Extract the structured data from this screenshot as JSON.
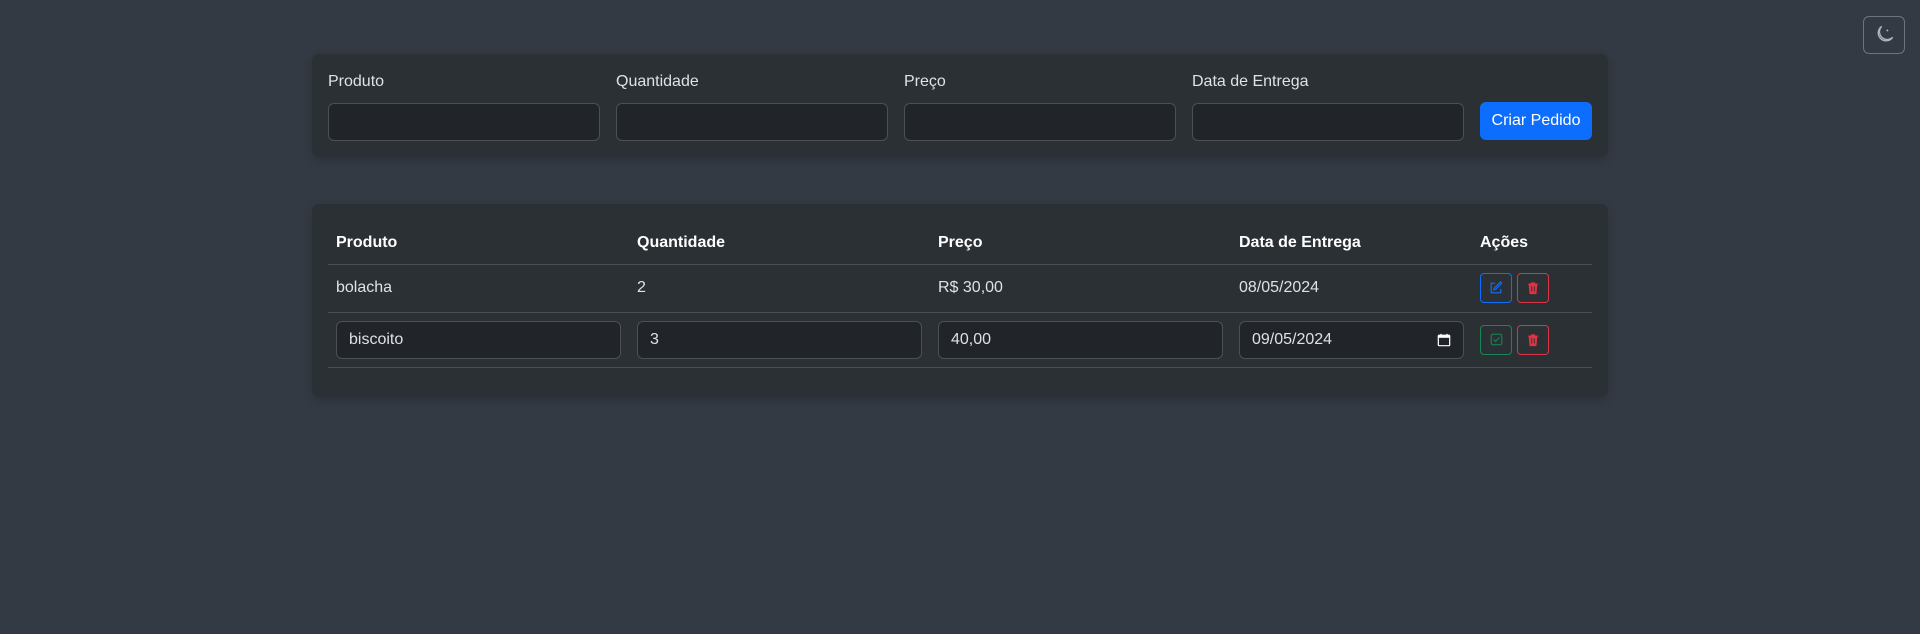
{
  "theme_toggle": {
    "icon": "moon-stars-icon"
  },
  "form": {
    "fields": [
      {
        "label": "Produto",
        "value": ""
      },
      {
        "label": "Quantidade",
        "value": ""
      },
      {
        "label": "Preço",
        "value": ""
      },
      {
        "label": "Data de Entrega",
        "value": ""
      }
    ],
    "submit_label": "Criar Pedido"
  },
  "table": {
    "headers": [
      "Produto",
      "Quantidade",
      "Preço",
      "Data de Entrega",
      "Ações"
    ],
    "rows": [
      {
        "produto": "bolacha",
        "quantidade": "2",
        "preco": "R$ 30,00",
        "data": "08/05/2024",
        "mode": "view"
      },
      {
        "produto": "biscoito",
        "quantidade": "3",
        "preco": "40,00",
        "data": "09/05/2024",
        "mode": "edit"
      }
    ]
  },
  "colors": {
    "background": "#343a43",
    "card": "#2b3035",
    "primary": "#0d6efd",
    "danger": "#dc3545",
    "success": "#198754"
  }
}
